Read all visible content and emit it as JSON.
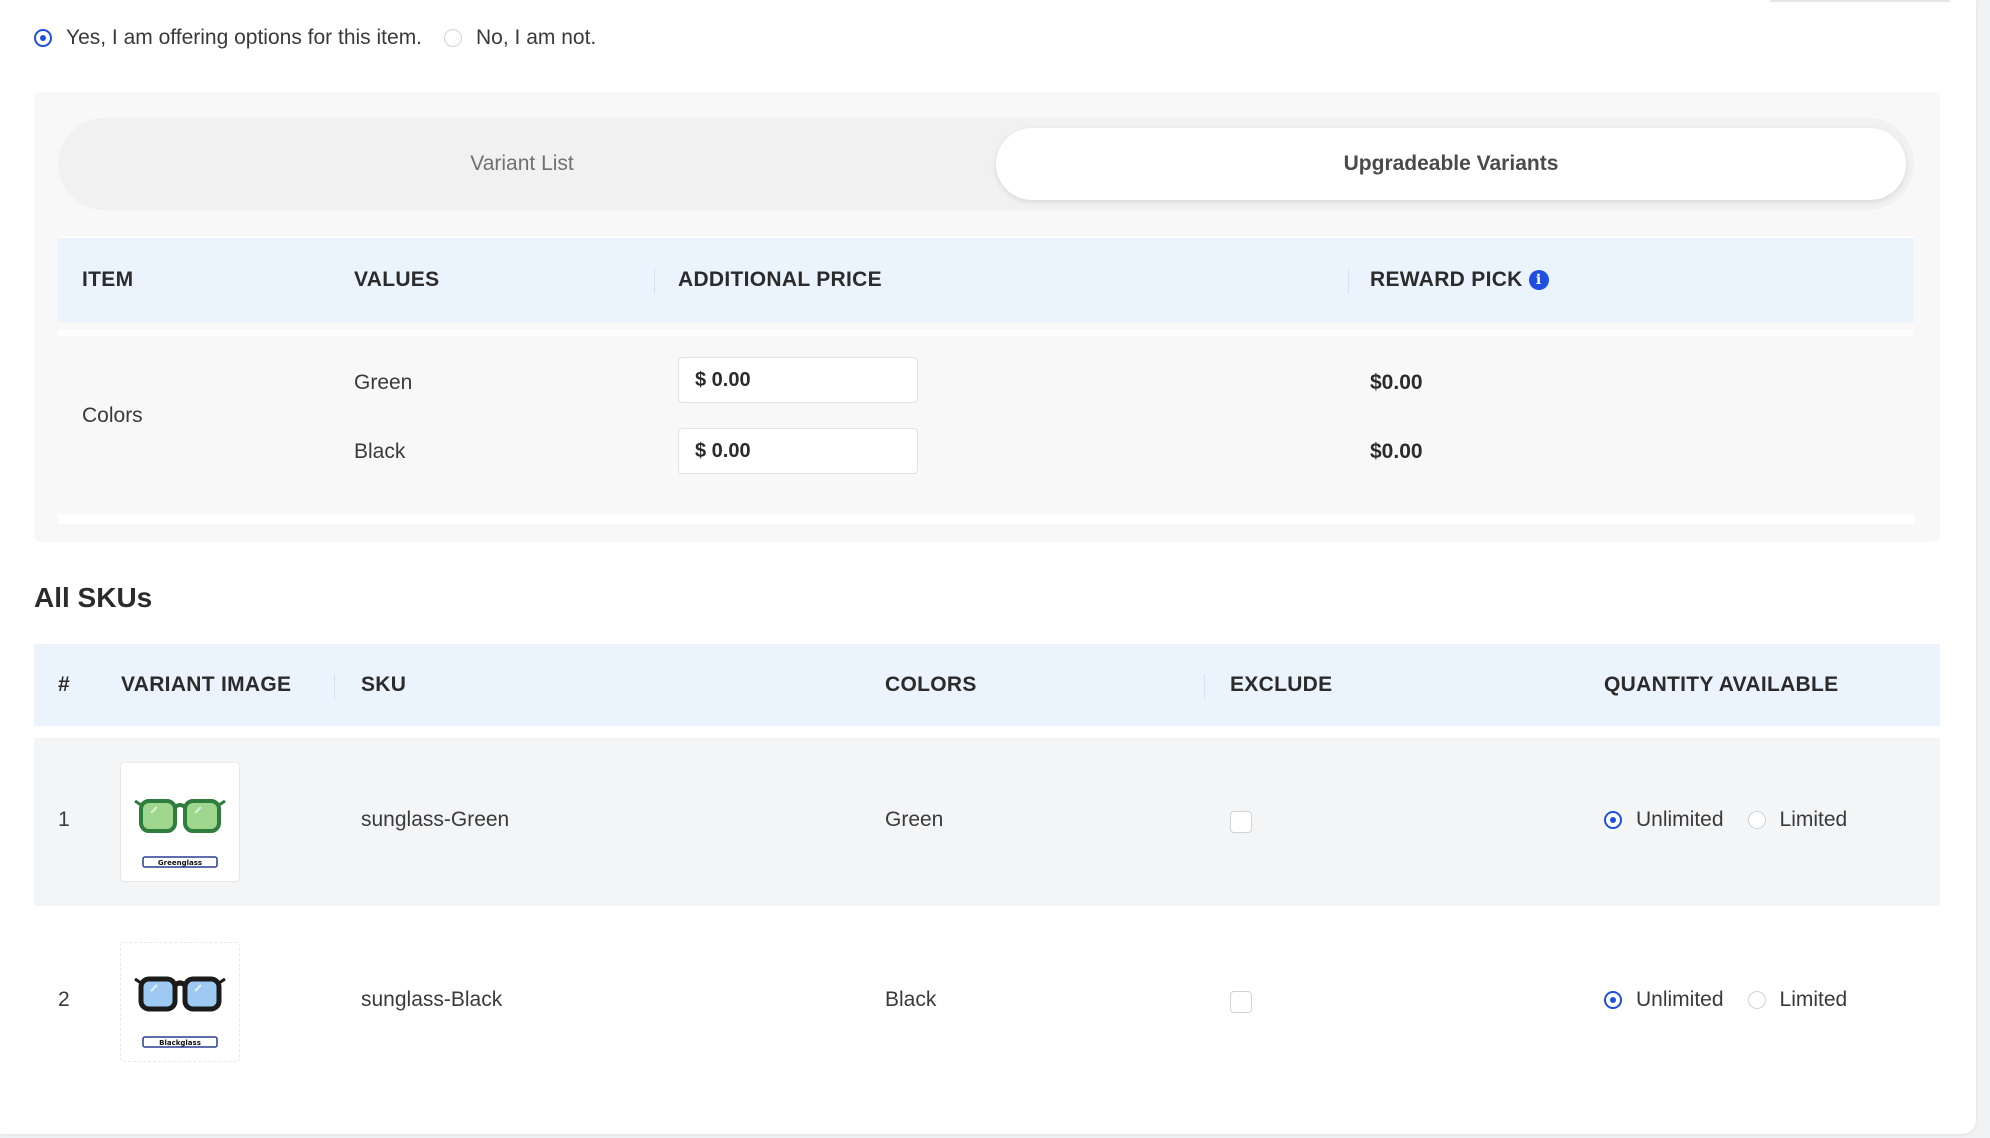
{
  "options": {
    "yes_label": "Yes, I am offering options for this item.",
    "no_label": "No, I am not.",
    "selected": "yes"
  },
  "tabs": {
    "variant_list": "Variant List",
    "upgradeable_variants": "Upgradeable Variants",
    "active": "upgradeable_variants"
  },
  "variants_table": {
    "headers": {
      "item": "ITEM",
      "values": "VALUES",
      "additional_price": "ADDITIONAL PRICE",
      "reward_pick": "REWARD PICK"
    },
    "item_name": "Colors",
    "rows": [
      {
        "value": "Green",
        "price": "$ 0.00",
        "reward_pick": "$0.00"
      },
      {
        "value": "Black",
        "price": "$ 0.00",
        "reward_pick": "$0.00"
      }
    ]
  },
  "skus": {
    "title": "All SKUs",
    "headers": {
      "index": "#",
      "variant_image": "VARIANT IMAGE",
      "sku": "SKU",
      "colors": "COLORS",
      "exclude": "EXCLUDE",
      "quantity": "QUANTITY AVAILABLE"
    },
    "rows": [
      {
        "index": "1",
        "sku": "sunglass-Green",
        "color": "Green",
        "image_caption": "Greenglass",
        "excluded": false,
        "quantity": "unlimited"
      },
      {
        "index": "2",
        "sku": "sunglass-Black",
        "color": "Black",
        "image_caption": "Blackglass",
        "excluded": false,
        "quantity": "unlimited"
      }
    ],
    "unlimited_label": "Unlimited",
    "limited_label": "Limited"
  },
  "colors": {
    "accent": "#1f4fe0",
    "header_bg": "#ebf3fd",
    "green_frame": "#2f7d3c",
    "green_lens": "#9fd68e",
    "black_frame": "#1b1b1b",
    "blue_lens": "#9ec9f2"
  }
}
